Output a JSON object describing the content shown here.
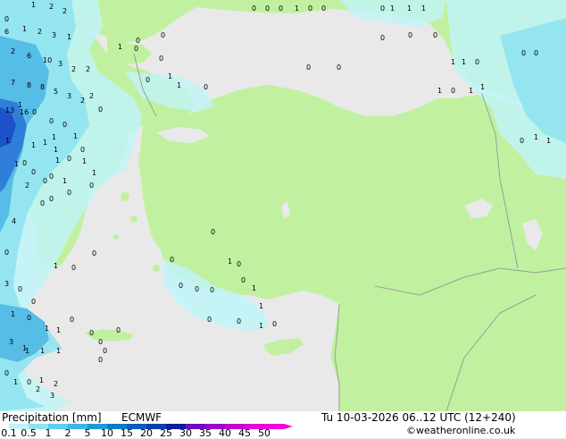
{
  "map": {
    "region": "Turkey / Eastern Mediterranean",
    "colors": {
      "sea": "#e9e9e9",
      "land": "#c1f1a0",
      "border": "#9b9b9b",
      "precip_light": "#c0f4f8",
      "precip_mid": "#8fe3ef",
      "precip_blue": "#55bde6",
      "precip_dark": "#2f7fd8",
      "precip_darker": "#1c51c9"
    },
    "precip_labels": [
      "0",
      "1",
      "2",
      "2",
      "6",
      "1",
      "2",
      "3",
      "1",
      "2",
      "6",
      "10",
      "3",
      "2",
      "2",
      "7",
      "8",
      "8",
      "5",
      "3",
      "2",
      "0",
      "0",
      "0",
      "1",
      "0",
      "0",
      "0",
      "1",
      "1",
      "1",
      "0",
      "0",
      "0",
      "0",
      "1",
      "0",
      "1",
      "1",
      "2",
      "0",
      "1",
      "1",
      "0",
      "0",
      "0",
      "1",
      "0",
      "1",
      "1",
      "0",
      "1",
      "1",
      "0",
      "0",
      "0",
      "1",
      "0",
      "0",
      "0",
      "1",
      "0",
      "1",
      "0",
      "0",
      "0",
      "0",
      "0",
      "1",
      "0",
      "1",
      "0",
      "0",
      "0",
      "0",
      "0",
      "0",
      "0",
      "13",
      "16",
      "1",
      "1",
      "1",
      "1",
      "1",
      "1",
      "0",
      "1",
      "1",
      "2",
      "0",
      "0",
      "4",
      "0",
      "3",
      "0",
      "0",
      "0",
      "0",
      "0",
      "0",
      "1",
      "0",
      "0",
      "0",
      "1",
      "1",
      "0",
      "1",
      "0",
      "0",
      "1",
      "0",
      "3",
      "1",
      "1",
      "1",
      "0",
      "1",
      "2",
      "2",
      "3",
      "0",
      "0",
      "1",
      "1",
      "1",
      "1",
      "0",
      "0",
      "0"
    ]
  },
  "footer": {
    "title": "Precipitation [mm]",
    "model": "ECMWF",
    "datetime": "Tu 10-03-2026 06..12 UTC (12+240)",
    "credit": "©weatheronline.co.uk"
  },
  "colorbar": {
    "ticks": [
      "0.1",
      "0.5",
      "1",
      "2",
      "5",
      "10",
      "15",
      "20",
      "25",
      "30",
      "35",
      "40",
      "45",
      "50"
    ],
    "colors": [
      "#c0f4f8",
      "#8fe3ef",
      "#5fcfea",
      "#3ab7e5",
      "#1f9ad6",
      "#0c7bc6",
      "#0a5dba",
      "#0b3fad",
      "#0b1f9c",
      "#6a0fbf",
      "#9a06c8",
      "#c300cf",
      "#e400d6",
      "#f000e0"
    ]
  }
}
